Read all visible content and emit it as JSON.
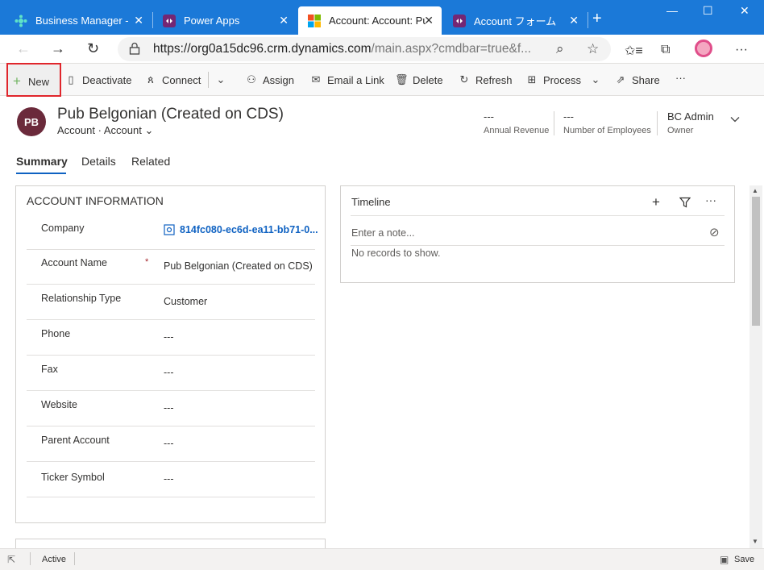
{
  "browser": {
    "tabs": [
      {
        "title": "Business Manager - D",
        "close": "✕"
      },
      {
        "title": "Power Apps",
        "close": "✕"
      },
      {
        "title": "Account: Account: Pu",
        "close": "✕"
      },
      {
        "title": "Account フォーム",
        "close": "✕"
      }
    ],
    "new_tab": "+",
    "url_host": "https://org0a15dc96.crm.dynamics.com",
    "url_rest": "/main.aspx?cmdbar=true&f...",
    "window_controls": [
      "—",
      "☐",
      "✕"
    ]
  },
  "commandbar": {
    "new": "New",
    "deactivate": "Deactivate",
    "connect": "Connect",
    "assign": "Assign",
    "email_link": "Email a Link",
    "delete": "Delete",
    "refresh": "Refresh",
    "process": "Process",
    "share": "Share",
    "more": "···"
  },
  "record": {
    "initials": "PB",
    "title": "Pub Belgonian (Created on CDS)",
    "entity": "Account",
    "form": "Account",
    "annual_revenue_value": "---",
    "annual_revenue_label": "Annual Revenue",
    "employees_value": "---",
    "employees_label": "Number of Employees",
    "owner_name": "BC Admin",
    "owner_label": "Owner"
  },
  "section_tabs": [
    "Summary",
    "Details",
    "Related"
  ],
  "account_info": {
    "title": "ACCOUNT INFORMATION",
    "fields": [
      {
        "label": "Company",
        "value": "814fc080-ec6d-ea11-bb71-0..."
      },
      {
        "label": "Account Name",
        "value": "Pub Belgonian (Created on CDS)",
        "required": "*"
      },
      {
        "label": "Relationship Type",
        "value": "Customer"
      },
      {
        "label": "Phone",
        "value": "---"
      },
      {
        "label": "Fax",
        "value": "---"
      },
      {
        "label": "Website",
        "value": "---"
      },
      {
        "label": "Parent Account",
        "value": "---"
      },
      {
        "label": "Ticker Symbol",
        "value": "---"
      }
    ]
  },
  "timeline": {
    "title": "Timeline",
    "note_placeholder": "Enter a note...",
    "empty": "No records to show.",
    "more": "···"
  },
  "status": {
    "state": "Active",
    "save": "Save"
  }
}
